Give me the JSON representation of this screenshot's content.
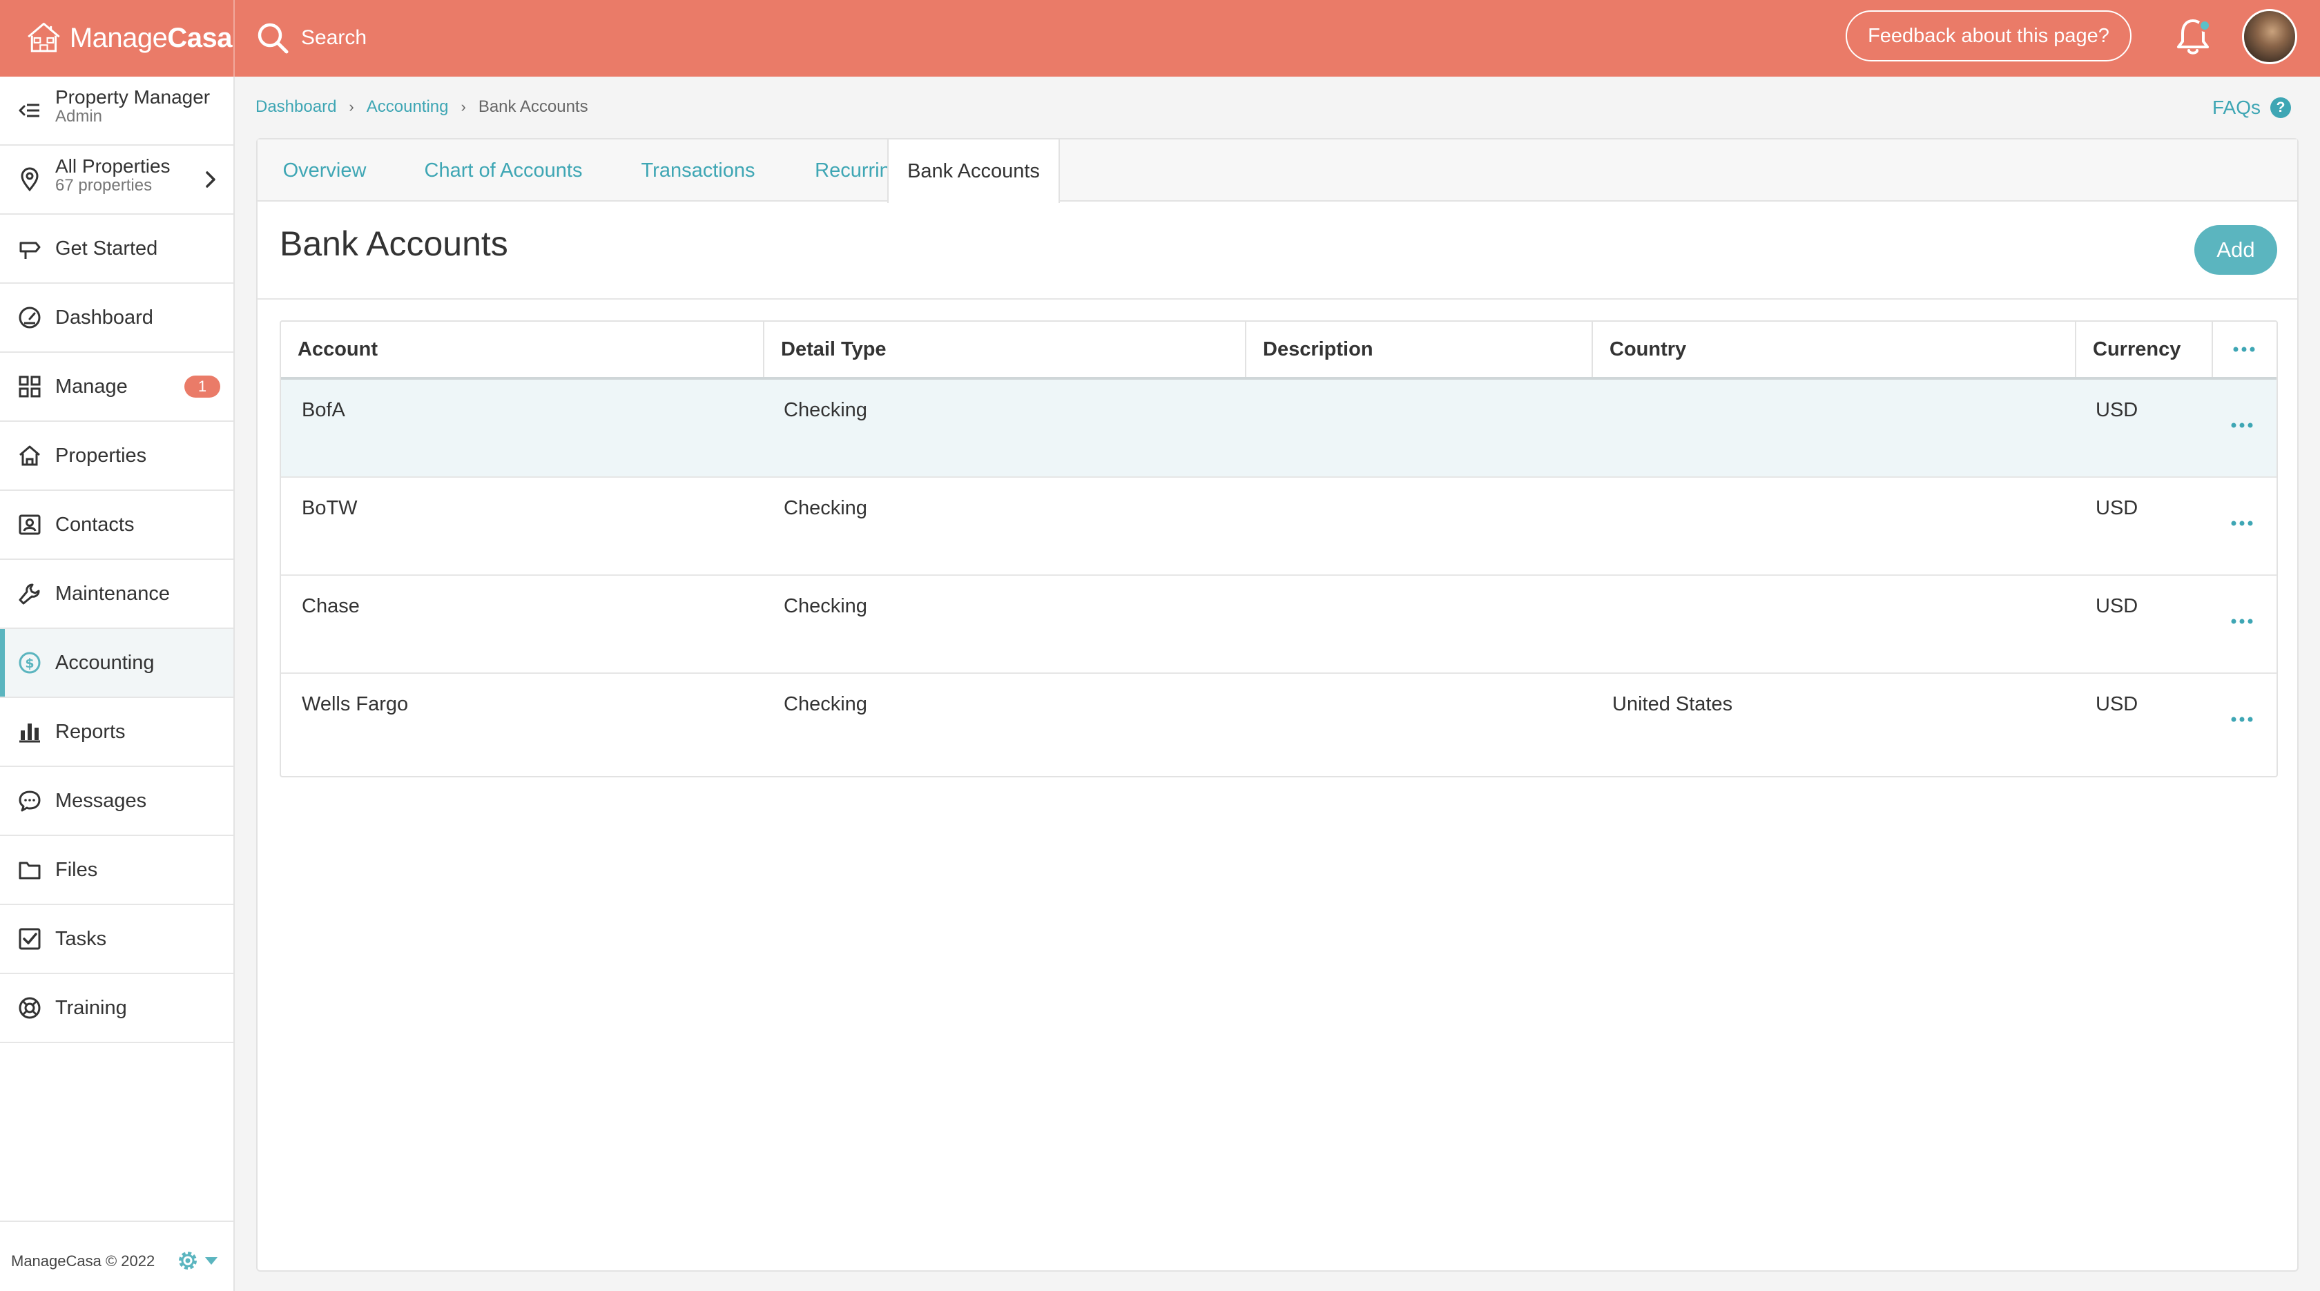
{
  "app": {
    "brand_light": "Manage",
    "brand_bold": "Casa",
    "accent_color": "#ea7b68",
    "teal_color": "#5bb5bf"
  },
  "topbar": {
    "search_label": "Search",
    "feedback_label": "Feedback about this page?",
    "icons": [
      "search-icon",
      "bell-icon",
      "avatar"
    ]
  },
  "sidebar": {
    "user": {
      "name": "Property Manager",
      "role": "Admin",
      "icon": "collapse-menu-icon"
    },
    "properties": {
      "label": "All Properties",
      "count": "67 properties",
      "icon": "location-pin-icon"
    },
    "items": [
      {
        "label": "Get Started",
        "icon": "signpost-icon"
      },
      {
        "label": "Dashboard",
        "icon": "gauge-icon"
      },
      {
        "label": "Manage",
        "icon": "grid-icon",
        "badge": "1"
      },
      {
        "label": "Properties",
        "icon": "house-icon"
      },
      {
        "label": "Contacts",
        "icon": "contact-card-icon"
      },
      {
        "label": "Maintenance",
        "icon": "wrench-icon"
      },
      {
        "label": "Accounting",
        "icon": "dollar-circle-icon",
        "active": true
      },
      {
        "label": "Reports",
        "icon": "bar-chart-icon"
      },
      {
        "label": "Messages",
        "icon": "chat-bubble-icon"
      },
      {
        "label": "Files",
        "icon": "folder-icon"
      },
      {
        "label": "Tasks",
        "icon": "checkbox-icon"
      },
      {
        "label": "Training",
        "icon": "lifebuoy-icon"
      }
    ],
    "footer": {
      "copyright": "ManageCasa © 2022",
      "icon": "gear-icon"
    }
  },
  "breadcrumb": {
    "items": [
      "Dashboard",
      "Accounting"
    ],
    "current": "Bank Accounts"
  },
  "faqs_label": "FAQs",
  "tabs": [
    {
      "label": "Overview"
    },
    {
      "label": "Chart of Accounts"
    },
    {
      "label": "Transactions"
    },
    {
      "label": "Recurring"
    },
    {
      "label": "Bank Accounts",
      "active": true
    }
  ],
  "page": {
    "title": "Bank Accounts",
    "add_label": "Add"
  },
  "table": {
    "columns": [
      "Account",
      "Detail Type",
      "Description",
      "Country",
      "Currency"
    ],
    "rows": [
      {
        "account": "BofA",
        "detail_type": "Checking",
        "description": "",
        "country": "",
        "currency": "USD"
      },
      {
        "account": "BoTW",
        "detail_type": "Checking",
        "description": "",
        "country": "",
        "currency": "USD"
      },
      {
        "account": "Chase",
        "detail_type": "Checking",
        "description": "",
        "country": "",
        "currency": "USD"
      },
      {
        "account": "Wells Fargo",
        "detail_type": "Checking",
        "description": "",
        "country": "United States",
        "currency": "USD"
      }
    ]
  }
}
